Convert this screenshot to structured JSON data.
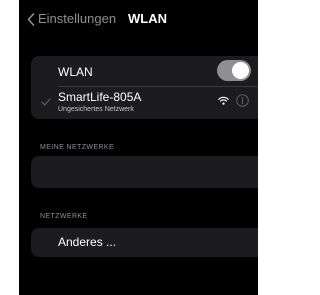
{
  "nav": {
    "back_label": "Einstellungen",
    "title": "WLAN"
  },
  "wlan": {
    "label": "WLAN",
    "enabled": true
  },
  "current_network": {
    "name": "SmartLife-805A",
    "subtitle": "Ungesichertes Netzwerk",
    "connected": true,
    "signal_icon": "wifi-icon",
    "info_icon": "info-icon"
  },
  "my_networks": {
    "header": "MEINE NETZWERKE",
    "items": []
  },
  "networks": {
    "header": "NETZWERKE",
    "other_label": "Anderes ..."
  },
  "colors": {
    "background": "#000000",
    "group": "#1c1c1e",
    "secondary_text": "#8e8e93",
    "toggle": "#8e8e93"
  }
}
